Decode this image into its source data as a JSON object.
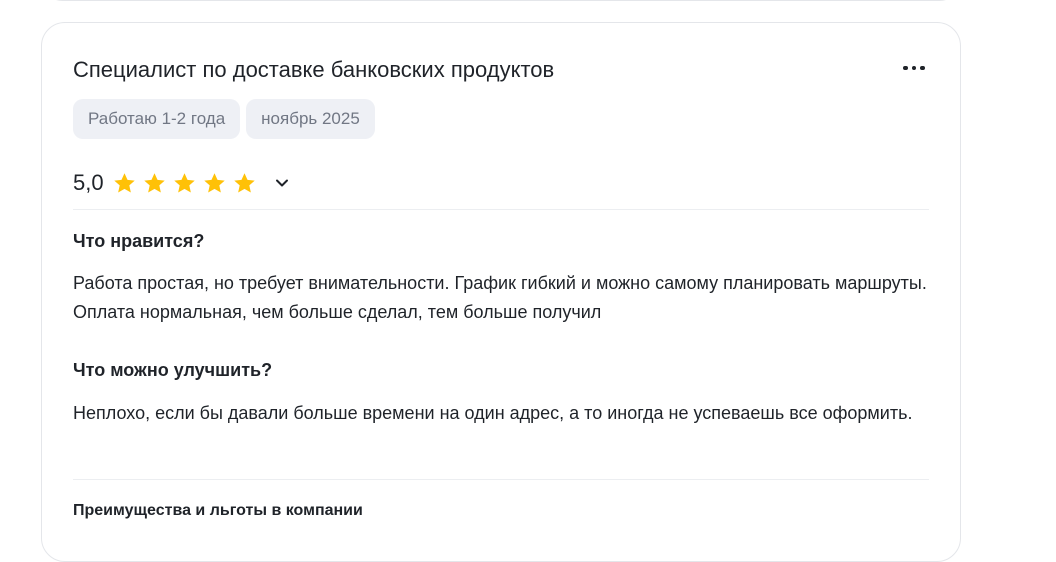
{
  "review": {
    "title": "Специалист по доставке банковских продуктов",
    "more_icon": "more-horizontal-icon",
    "tags": [
      "Работаю 1-2 года",
      "ноябрь 2025"
    ],
    "rating": {
      "value_text": "5,0",
      "stars": 5,
      "max_stars": 5,
      "star_color": "#ffc107"
    },
    "likes": {
      "title": "Что нравится?",
      "text": "Работа простая, но требует внимательности. График гибкий и можно самому планировать маршруты. Оплата нормальная, чем больше сделал, тем больше получил"
    },
    "improve": {
      "title": "Что можно улучшить?",
      "text": "Неплохо, если бы давали больше времени на один адрес, а то иногда не успеваешь все оформить."
    },
    "benefits": {
      "title": "Преимущества и льготы в компании"
    }
  }
}
